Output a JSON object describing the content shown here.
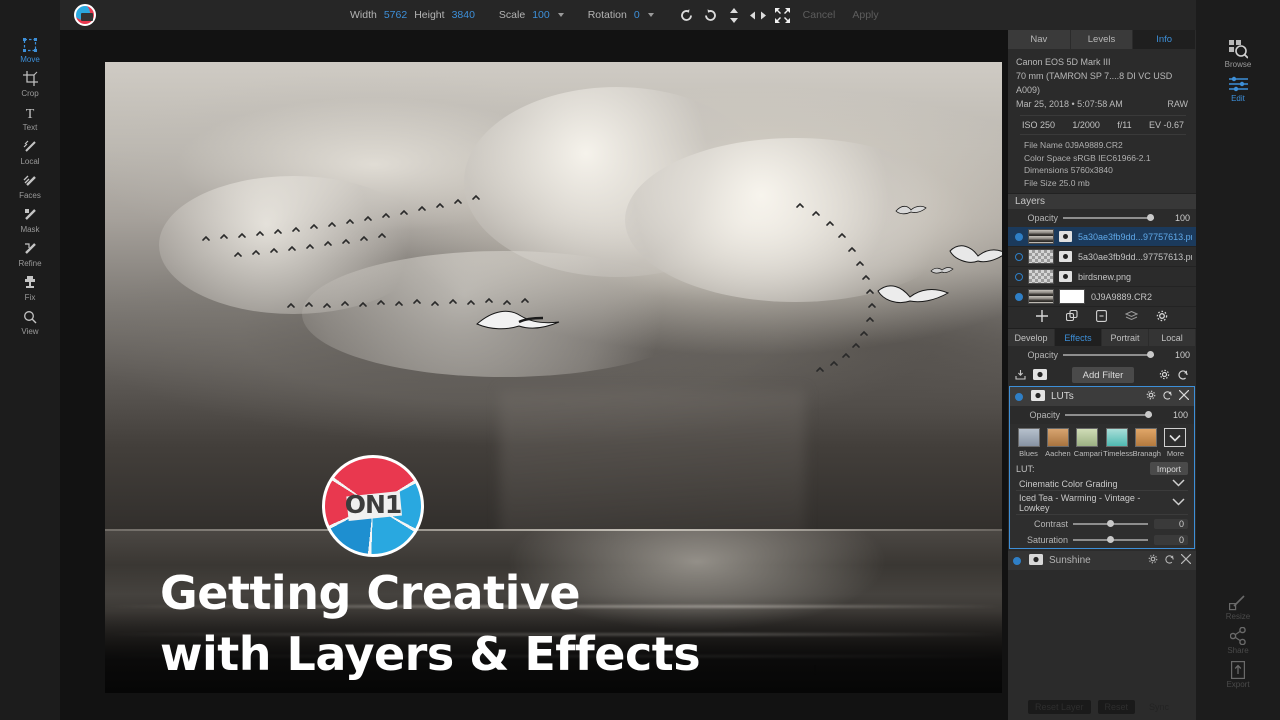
{
  "titlebar": {
    "app_icon": "on1-logo-icon",
    "width_label": "Width",
    "width_value": "5762",
    "height_label": "Height",
    "height_value": "3840",
    "scale_label": "Scale",
    "scale_value": "100",
    "rotation_label": "Rotation",
    "rotation_value": "0",
    "cancel_label": "Cancel",
    "apply_label": "Apply"
  },
  "left_tools": [
    {
      "label": "Move",
      "icon": "move-icon",
      "active": true
    },
    {
      "label": "Crop",
      "icon": "crop-icon",
      "active": false
    },
    {
      "label": "Text",
      "icon": "text-icon",
      "active": false
    },
    {
      "label": "Local",
      "icon": "local-brush-icon",
      "active": false
    },
    {
      "label": "Faces",
      "icon": "faces-icon",
      "active": false
    },
    {
      "label": "Mask",
      "icon": "mask-brush-icon",
      "active": false
    },
    {
      "label": "Refine",
      "icon": "refine-brush-icon",
      "active": false
    },
    {
      "label": "Fix",
      "icon": "clone-stamp-icon",
      "active": false
    },
    {
      "label": "View",
      "icon": "magnifier-icon",
      "active": false
    }
  ],
  "right_rail": {
    "top": [
      {
        "label": "Browse",
        "icon": "browse-icon",
        "active": false
      },
      {
        "label": "Edit",
        "icon": "sliders-icon",
        "active": true
      }
    ],
    "bottom": [
      {
        "label": "Resize",
        "icon": "resize-icon"
      },
      {
        "label": "Share",
        "icon": "share-icon"
      },
      {
        "label": "Export",
        "icon": "export-icon"
      }
    ]
  },
  "canvas": {
    "logo_text": "ON1",
    "overlay_title_line1": "Getting Creative",
    "overlay_title_line2": "with Layers & Effects"
  },
  "panel": {
    "top_tabs": [
      {
        "label": "Nav",
        "active": false
      },
      {
        "label": "Levels",
        "active": false
      },
      {
        "label": "Info",
        "active": true
      }
    ],
    "info": {
      "camera": "Canon EOS 5D Mark III",
      "lens": "70 mm (TAMRON SP 7....8 DI VC USD A009)",
      "datetime": "Mar 25, 2018 • 5:07:58 AM",
      "format": "RAW",
      "iso": "ISO 250",
      "shutter": "1/2000",
      "aperture": "f/11",
      "ev": "EV -0.67",
      "file_name": "File Name 0J9A9889.CR2",
      "color_space": "Color Space sRGB IEC61966-2.1",
      "dimensions": "Dimensions 5760x3840",
      "file_size": "File Size 25.0 mb"
    },
    "layers": {
      "header": "Layers",
      "opacity_label": "Opacity",
      "opacity_value": "100",
      "items": [
        {
          "name": "5a30ae3fb9dd...97757613.png",
          "visible": true,
          "selected": true,
          "thumb": "photo",
          "has_mask": true
        },
        {
          "name": "5a30ae3fb9dd...97757613.png",
          "visible": false,
          "selected": false,
          "thumb": "transparent",
          "has_mask": true
        },
        {
          "name": "birdsnew.png",
          "visible": false,
          "selected": false,
          "thumb": "transparent",
          "has_mask": true
        },
        {
          "name": "0J9A9889.CR2",
          "visible": true,
          "selected": false,
          "thumb": "photo",
          "has_mask": false,
          "mask_white": true
        }
      ],
      "tools": [
        "add-layer-icon",
        "duplicate-layer-icon",
        "delete-layer-icon",
        "merge-layers-icon",
        "layer-settings-icon"
      ]
    },
    "module_tabs": [
      {
        "label": "Develop",
        "active": false
      },
      {
        "label": "Effects",
        "active": true
      },
      {
        "label": "Portrait",
        "active": false
      },
      {
        "label": "Local",
        "active": false
      }
    ],
    "effects": {
      "opacity_label": "Opacity",
      "opacity_value": "100",
      "add_filter_label": "Add Filter",
      "filter": {
        "name": "LUTs",
        "enabled": true,
        "opacity_label": "Opacity",
        "opacity_value": "100",
        "presets": [
          {
            "label": "Blues",
            "color": "#9aa6b4"
          },
          {
            "label": "Aachen",
            "color": "#c08b55"
          },
          {
            "label": "Campari",
            "color": "#b6c79f"
          },
          {
            "label": "Timeless",
            "color": "#72c9c2"
          },
          {
            "label": "Branagh",
            "color": "#d19258"
          },
          {
            "label": "More",
            "color": ""
          }
        ],
        "lut_label": "LUT:",
        "import_label": "Import",
        "category_value": "Cinematic Color Grading",
        "preset_value": "Iced Tea - Warming - Vintage - Lowkey",
        "sliders": [
          {
            "label": "Contrast",
            "value": "0"
          },
          {
            "label": "Saturation",
            "value": "0"
          }
        ]
      },
      "next_filter": {
        "name": "Sunshine",
        "enabled": true
      }
    },
    "bottom_buttons": [
      {
        "label": "Reset Layer"
      },
      {
        "label": "Reset"
      },
      {
        "label": "Sync"
      }
    ]
  },
  "theme": {
    "accent": "#3d8fd8",
    "panel_bg": "#2b2b2b",
    "logo_blue": "#29a8e0",
    "logo_red": "#e9384f"
  }
}
